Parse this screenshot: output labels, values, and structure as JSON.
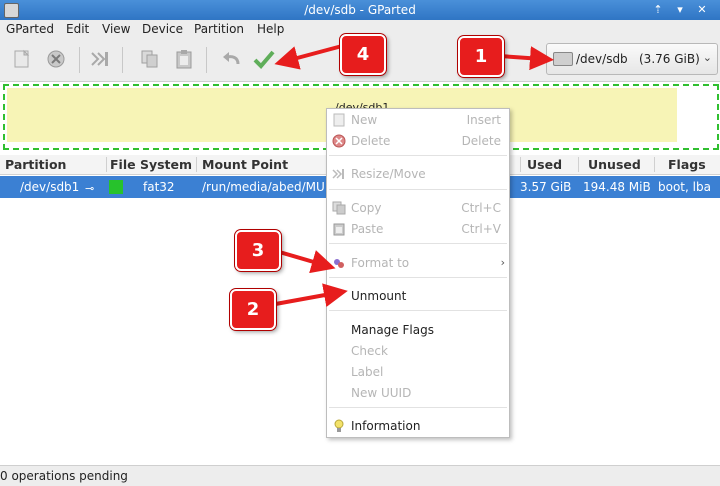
{
  "window": {
    "title": "/dev/sdb - GParted"
  },
  "menubar": {
    "items": [
      "GParted",
      "Edit",
      "View",
      "Device",
      "Partition",
      "Help"
    ]
  },
  "toolbar": {
    "buttons": [
      "new-icon",
      "delete-icon",
      "resize-move-icon",
      "copy-icon",
      "paste-icon",
      "undo-icon",
      "apply-icon"
    ]
  },
  "device_selector": {
    "name": "/dev/sdb",
    "size": "(3.76 GiB)"
  },
  "disk_map": {
    "label": "/dev/sdb1",
    "used_color": "#f7f4b6",
    "border_color": "#2fbf2f"
  },
  "table": {
    "headers": [
      "Partition",
      "File System",
      "Mount Point",
      "Used",
      "Unused",
      "Flags"
    ],
    "rows": [
      {
        "partition": "/dev/sdb1",
        "file_system": "fat32",
        "fs_color": "#27c22c",
        "mount_point": "/run/media/abed/MU",
        "used": "3.57 GiB",
        "unused": "194.48 MiB",
        "flags": "boot, lba"
      }
    ]
  },
  "context_menu": {
    "items": [
      {
        "label": "New",
        "accel": "Insert",
        "enabled": false
      },
      {
        "label": "Delete",
        "accel": "Delete",
        "enabled": false
      },
      {
        "label": "Resize/Move",
        "accel": "",
        "enabled": false
      },
      {
        "label": "Copy",
        "accel": "Ctrl+C",
        "enabled": false
      },
      {
        "label": "Paste",
        "accel": "Ctrl+V",
        "enabled": false
      },
      {
        "label": "Format to",
        "accel": "",
        "enabled": false
      },
      {
        "label": "Unmount",
        "accel": "",
        "enabled": true
      },
      {
        "label": "Manage Flags",
        "accel": "",
        "enabled": true
      },
      {
        "label": "Check",
        "accel": "",
        "enabled": false
      },
      {
        "label": "Label",
        "accel": "",
        "enabled": false
      },
      {
        "label": "New UUID",
        "accel": "",
        "enabled": false
      },
      {
        "label": "Information",
        "accel": "",
        "enabled": true
      }
    ]
  },
  "status": {
    "text": "0 operations pending"
  },
  "annotations": {
    "callouts": [
      "1",
      "2",
      "3",
      "4"
    ],
    "color": "#e71d1d"
  }
}
